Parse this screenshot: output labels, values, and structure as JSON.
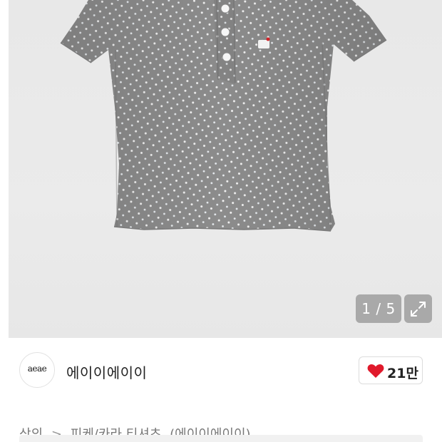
{
  "gallery": {
    "counter": "1 / 5",
    "expand_icon": "expand-icon"
  },
  "brand": {
    "logo_text": "aeae",
    "name": "에이이에이이"
  },
  "like": {
    "icon": "heart-icon",
    "count": "21만",
    "color": "#e0192b"
  },
  "breadcrumb": {
    "items": [
      "상의",
      "피케/카라 티셔츠",
      "(에이이에이이)"
    ],
    "separator": ">"
  }
}
